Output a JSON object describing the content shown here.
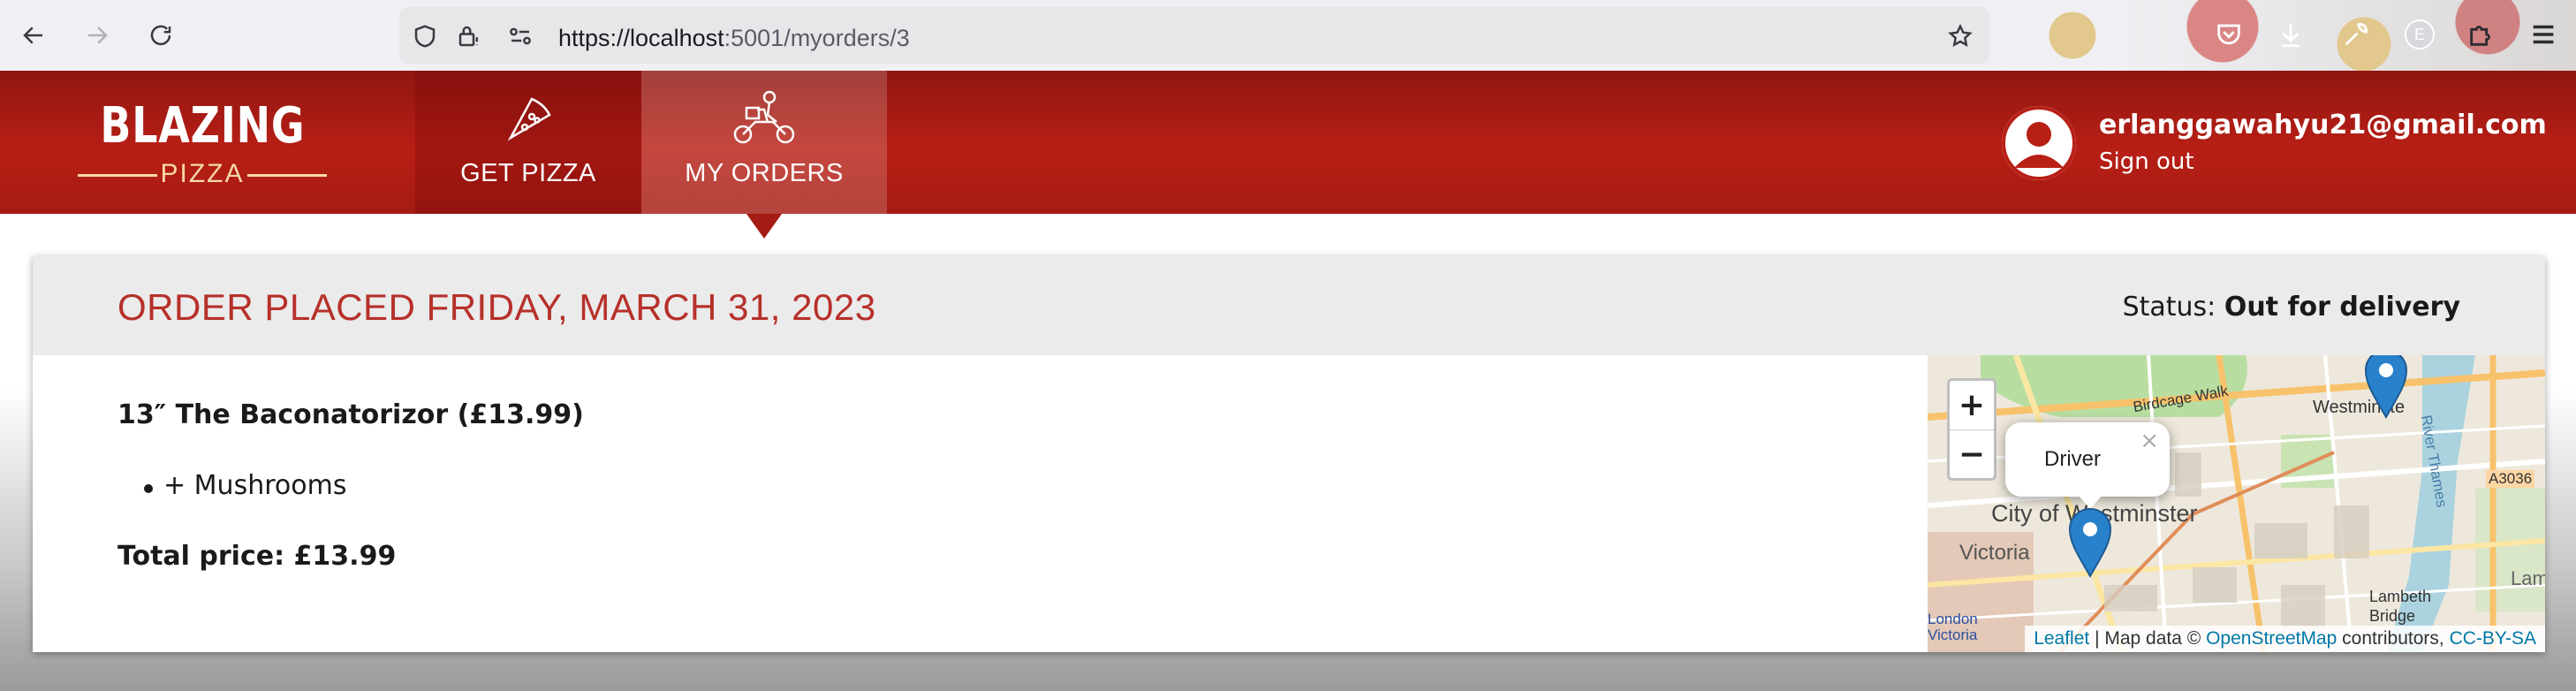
{
  "browser": {
    "url_host": "https://localhost",
    "url_port": ":5001",
    "url_path": "/myorders/3",
    "extension_badge": "E"
  },
  "header": {
    "logo_top": "BLAZING",
    "logo_bottom": "PIZZA",
    "nav": [
      {
        "label": "GET PIZZA",
        "icon": "pizza-slice-icon"
      },
      {
        "label": "MY ORDERS",
        "icon": "delivery-bike-icon",
        "active": true
      }
    ],
    "user": {
      "email": "erlanggawahyu21@gmail.com",
      "sign_out_label": "Sign out"
    }
  },
  "order": {
    "title": "ORDER PLACED FRIDAY, MARCH 31, 2023",
    "status_label": "Status:",
    "status_value": "Out for delivery",
    "pizza_line": "13″ The Baconatorizor (£13.99)",
    "toppings": [
      "+ Mushrooms"
    ],
    "total_label": "Total price:",
    "total_value": "£13.99"
  },
  "map": {
    "zoom_in": "+",
    "zoom_out": "−",
    "popup_text": "Driver",
    "popup_close": "×",
    "attribution_leaflet": "Leaflet",
    "attribution_mid": " | Map data © ",
    "attribution_osm": "OpenStreetMap",
    "attribution_contrib": " contributors, ",
    "attribution_license": "CC-BY-SA",
    "labels": {
      "birdcage": "Birdcage Walk",
      "westminster": "Westminste",
      "city": "City of Westminster",
      "victoria": "Victoria",
      "london_victoria": "London Victoria",
      "lambeth": "Lambeth Bridge",
      "lamb": "Lamb",
      "river": "River Thames",
      "road": "A3036"
    }
  },
  "colors": {
    "brand_red": "#b81f15",
    "title_red": "#b7302a",
    "marker_blue": "#2a81cb"
  }
}
